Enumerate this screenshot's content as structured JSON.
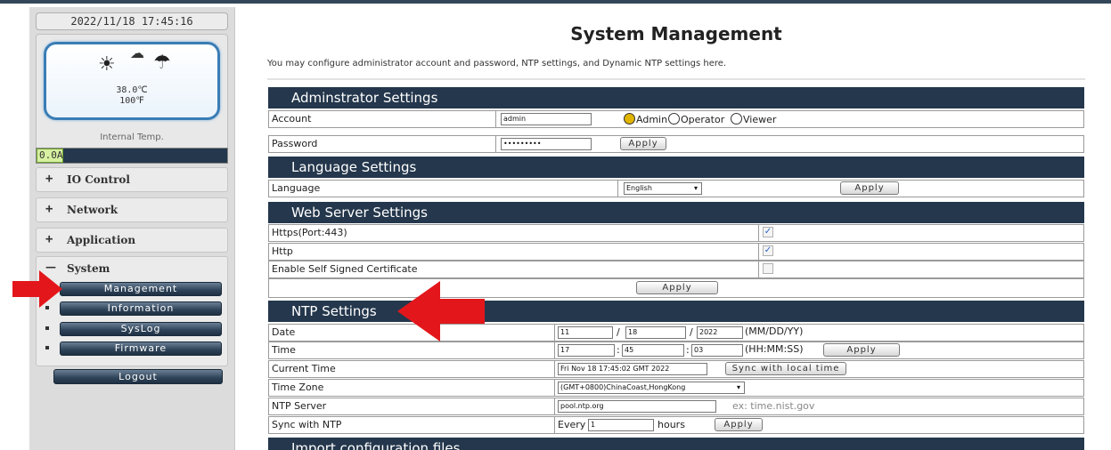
{
  "sidebar": {
    "datetime": "2022/11/18 17:45:16",
    "temp_c": "38.0℃",
    "temp_f": "100℉",
    "internal_label": "Internal Temp.",
    "current": "0.0A",
    "groups": [
      {
        "sign": "+",
        "label": "IO Control"
      },
      {
        "sign": "+",
        "label": "Network"
      },
      {
        "sign": "+",
        "label": "Application"
      }
    ],
    "system": {
      "sign": "—",
      "label": "System",
      "items": [
        "Management",
        "Information",
        "SysLog",
        "Firmware"
      ]
    },
    "logout": "Logout"
  },
  "page": {
    "title": "System Management",
    "description": "You may configure administrator account and password, NTP settings, and Dynamic NTP settings here."
  },
  "admin": {
    "header": "Adminstrator Settings",
    "account_label": "Account",
    "account_value": "admin",
    "role_admin": "Admin",
    "role_operator": "Operator",
    "role_viewer": "Viewer",
    "password_label": "Password",
    "password_value": "•••••••••",
    "apply": "Apply"
  },
  "language": {
    "header": "Language Settings",
    "label": "Language",
    "value": "English",
    "apply": "Apply"
  },
  "webserver": {
    "header": "Web Server Settings",
    "https_label": "Https(Port:443)",
    "https_checked": true,
    "http_label": "Http",
    "http_checked": true,
    "selfsigned_label": "Enable Self Signed Certificate",
    "selfsigned_checked": false,
    "apply": "Apply",
    "check_mark": "✓"
  },
  "ntp": {
    "header": "NTP Settings",
    "date_label": "Date",
    "date_month": "11",
    "date_day": "18",
    "date_year": "2022",
    "date_sep": "/",
    "date_format": "(MM/DD/YY)",
    "time_label": "Time",
    "time_hh": "17",
    "time_mm": "45",
    "time_ss": "03",
    "time_sep": ":",
    "time_format": "(HH:MM:SS)",
    "time_apply": "Apply",
    "current_label": "Current Time",
    "current_value": "Fri Nov 18 17:45:02 GMT 2022",
    "sync_local": "Sync with local time",
    "tz_label": "Time Zone",
    "tz_value": "(GMT+0800)ChinaCoast,HongKong",
    "server_label": "NTP Server",
    "server_value": "pool.ntp.org",
    "server_hint": "ex: time.nist.gov",
    "sync_label": "Sync with NTP",
    "sync_every": "Every",
    "sync_value": "1",
    "sync_unit": "hours",
    "sync_apply": "Apply"
  },
  "import": {
    "header": "Import configuration files"
  },
  "colors": {
    "header_bg": "#24374c",
    "arrow": "#e3171b",
    "lcd_border": "#3a7db5"
  }
}
